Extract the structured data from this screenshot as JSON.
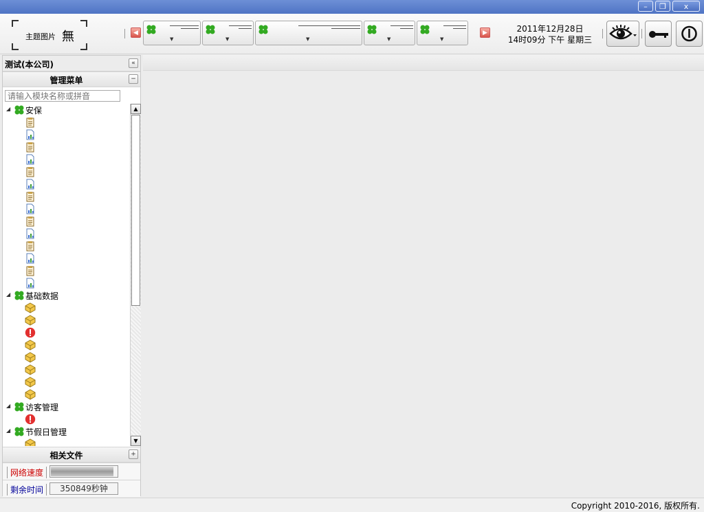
{
  "window": {
    "minimize_label": "–",
    "restore_label": "❐",
    "close_label": "x"
  },
  "toolbar": {
    "theme_label": "主题图片",
    "theme_glyph": "無",
    "prev_arrow": "◀",
    "next_arrow": "▶",
    "date": "2011年12月28日",
    "time": "14时09分 下午 星期三",
    "groups": [
      "",
      "",
      "",
      "",
      ""
    ]
  },
  "sidebar": {
    "title": "测试(本公司)",
    "collapse_glyph": "«",
    "menu_header": "管理菜单",
    "menu_toggle": "−",
    "search_placeholder": "请输入模块名称或拼音",
    "tree": [
      {
        "label": "安保",
        "leaves": [
          "doc",
          "chart",
          "doc",
          "chart",
          "doc",
          "chart",
          "doc",
          "chart",
          "doc",
          "chart",
          "doc",
          "chart",
          "doc",
          "chart"
        ]
      },
      {
        "label": "基础数据",
        "leaves": [
          "box",
          "box",
          "alert",
          "box",
          "box",
          "box",
          "box",
          "box"
        ]
      },
      {
        "label": "访客管理",
        "leaves": [
          "alert"
        ]
      },
      {
        "label": "节假日管理",
        "leaves": [
          "box"
        ]
      }
    ],
    "files_header": "相关文件",
    "files_toggle": "+",
    "network_label": "网络速度",
    "network_progress": 0.93,
    "remaining_label": "剩余时间",
    "remaining_value": "350849秒钟"
  },
  "colors": {
    "titlebar": "#5a7fcf",
    "network_label": "#cc0000",
    "remaining_label": "#000099",
    "group_icon": "#33aa22"
  },
  "footer": {
    "copyright": "Copyright 2010-2016, 版权所有."
  }
}
